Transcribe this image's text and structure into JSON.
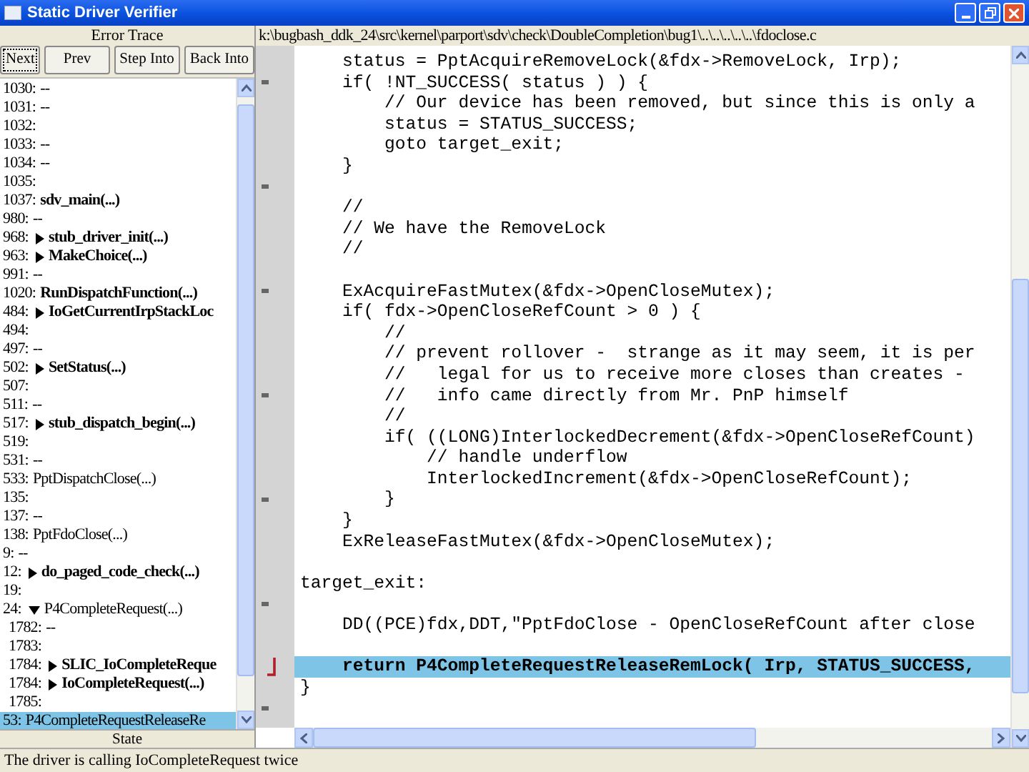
{
  "window": {
    "title": "Static Driver Verifier"
  },
  "error_trace": {
    "title": "Error Trace",
    "buttons": [
      {
        "label": "Next",
        "focused": true
      },
      {
        "label": "Prev",
        "focused": false
      },
      {
        "label": "Step Into",
        "focused": false
      },
      {
        "label": "Back Into",
        "focused": false
      }
    ],
    "items": [
      {
        "line": "1030:",
        "label": "--",
        "bold": false,
        "selected": false
      },
      {
        "line": "1031:",
        "label": "--",
        "bold": false,
        "selected": false
      },
      {
        "line": "1032:",
        "selected": false
      },
      {
        "line": "1033:",
        "label": "--",
        "bold": false,
        "selected": false
      },
      {
        "line": "1034:",
        "label": "--",
        "bold": false,
        "selected": false
      },
      {
        "line": "1035:",
        "selected": false
      },
      {
        "line": "1037:",
        "label": "sdv_main(...)",
        "bold": true,
        "selected": false
      },
      {
        "line": "980:",
        "label": "--",
        "bold": false,
        "selected": false
      },
      {
        "line": "968:",
        "label": "stub_driver_init(...)",
        "bold": true,
        "expanded": false,
        "selected": false
      },
      {
        "line": "963:",
        "label": "MakeChoice(...)",
        "bold": true,
        "expanded": false,
        "selected": false
      },
      {
        "line": "991:",
        "label": "--",
        "bold": false,
        "selected": false
      },
      {
        "line": "1020:",
        "label": "RunDispatchFunction(...)",
        "bold": true,
        "selected": false
      },
      {
        "line": "484:",
        "label": "IoGetCurrentIrpStackLoc",
        "bold": true,
        "expanded": false,
        "selected": false
      },
      {
        "line": "494:",
        "selected": false
      },
      {
        "line": "497:",
        "label": "--",
        "bold": false,
        "selected": false
      },
      {
        "line": "502:",
        "label": "SetStatus(...)",
        "bold": true,
        "expanded": false,
        "selected": false
      },
      {
        "line": "507:",
        "selected": false
      },
      {
        "line": "511:",
        "label": "--",
        "bold": false,
        "selected": false
      },
      {
        "line": "517:",
        "label": "stub_dispatch_begin(...)",
        "bold": true,
        "expanded": false,
        "selected": false
      },
      {
        "line": "519:",
        "selected": false
      },
      {
        "line": "531:",
        "label": "--",
        "bold": false,
        "selected": false
      },
      {
        "line": "533:",
        "label": "PptDispatchClose(...)",
        "bold": false,
        "selected": false
      },
      {
        "line": "135:",
        "selected": false
      },
      {
        "line": "137:",
        "label": "--",
        "bold": false,
        "selected": false
      },
      {
        "line": "138:",
        "label": "PptFdoClose(...)",
        "bold": false,
        "selected": false
      },
      {
        "line": "9:",
        "label": "--",
        "bold": false,
        "selected": false
      },
      {
        "line": "12:",
        "label": "do_paged_code_check(...)",
        "bold": true,
        "expanded": false,
        "selected": false
      },
      {
        "line": "19:",
        "selected": false
      },
      {
        "line": "24:",
        "label": "P4CompleteRequest(...)",
        "bold": false,
        "expanded": true,
        "selected": false,
        "children": [
          {
            "line": "1782:",
            "label": "--",
            "bold": false,
            "selected": false
          },
          {
            "line": "1783:",
            "selected": false
          },
          {
            "line": "1784:",
            "label": "SLIC_IoCompleteReque",
            "bold": true,
            "expanded": false,
            "selected": false
          },
          {
            "line": "1784:",
            "label": "IoCompleteRequest(...)",
            "bold": true,
            "expanded": false,
            "selected": false
          },
          {
            "line": "1785:",
            "selected": false
          }
        ]
      },
      {
        "line": "53:",
        "label": "P4CompleteRequestReleaseRe",
        "bold": false,
        "selected": true
      }
    ],
    "state_header": "State"
  },
  "source": {
    "path": "k:\\bugbash_ddk_24\\src\\kernel\\parport\\sdv\\check\\DoubleCompletion\\bug1\\..\\..\\..\\..\\..\\fdoclose.c",
    "lines": [
      {
        "kind": "code",
        "text": "    status = PptAcquireRemoveLock(&fdx->RemoveLock, Irp);",
        "current": false
      },
      {
        "kind": "code",
        "text": "    if( !NT_SUCCESS( status ) ) {",
        "current": false
      },
      {
        "kind": "code",
        "text": "        // Our device has been removed, but since this is only a",
        "current": false
      },
      {
        "kind": "code",
        "text": "        status = STATUS_SUCCESS;",
        "current": false
      },
      {
        "kind": "code",
        "text": "        goto target_exit;",
        "current": false
      },
      {
        "kind": "code",
        "text": "    }",
        "current": false
      },
      {
        "kind": "blank"
      },
      {
        "kind": "code",
        "text": "    //",
        "current": false
      },
      {
        "kind": "code",
        "text": "    // We have the RemoveLock",
        "current": false
      },
      {
        "kind": "code",
        "text": "    //",
        "current": false
      },
      {
        "kind": "blank"
      },
      {
        "kind": "code",
        "text": "    ExAcquireFastMutex(&fdx->OpenCloseMutex);",
        "current": false
      },
      {
        "kind": "code",
        "text": "    if( fdx->OpenCloseRefCount > 0 ) {",
        "current": false
      },
      {
        "kind": "code",
        "text": "        //",
        "current": false
      },
      {
        "kind": "code",
        "text": "        // prevent rollover -  strange as it may seem, it is per",
        "current": false
      },
      {
        "kind": "code",
        "text": "        //   legal for us to receive more closes than creates -",
        "current": false
      },
      {
        "kind": "code",
        "text": "        //   info came directly from Mr. PnP himself",
        "current": false
      },
      {
        "kind": "code",
        "text": "        //",
        "current": false
      },
      {
        "kind": "code",
        "text": "        if( ((LONG)InterlockedDecrement(&fdx->OpenCloseRefCount)",
        "current": false
      },
      {
        "kind": "code",
        "text": "            // handle underflow",
        "current": false
      },
      {
        "kind": "code",
        "text": "            InterlockedIncrement(&fdx->OpenCloseRefCount);",
        "current": false
      },
      {
        "kind": "code",
        "text": "        }",
        "current": false
      },
      {
        "kind": "code",
        "text": "    }",
        "current": false
      },
      {
        "kind": "code",
        "text": "    ExReleaseFastMutex(&fdx->OpenCloseMutex);",
        "current": false
      },
      {
        "kind": "blank"
      },
      {
        "kind": "code",
        "text": "target_exit:",
        "current": false
      },
      {
        "kind": "blank"
      },
      {
        "kind": "code",
        "text": "    DD((PCE)fdx,DDT,\"PptFdoClose - OpenCloseRefCount after close",
        "current": false
      },
      {
        "kind": "blank"
      },
      {
        "kind": "code",
        "text": "    return P4CompleteRequestReleaseRemLock( Irp, STATUS_SUCCESS,",
        "current": true
      },
      {
        "kind": "code",
        "text": "}",
        "current": false
      },
      {
        "kind": "blank"
      }
    ]
  },
  "status_bar": "The driver is calling IoCompleteRequest twice"
}
